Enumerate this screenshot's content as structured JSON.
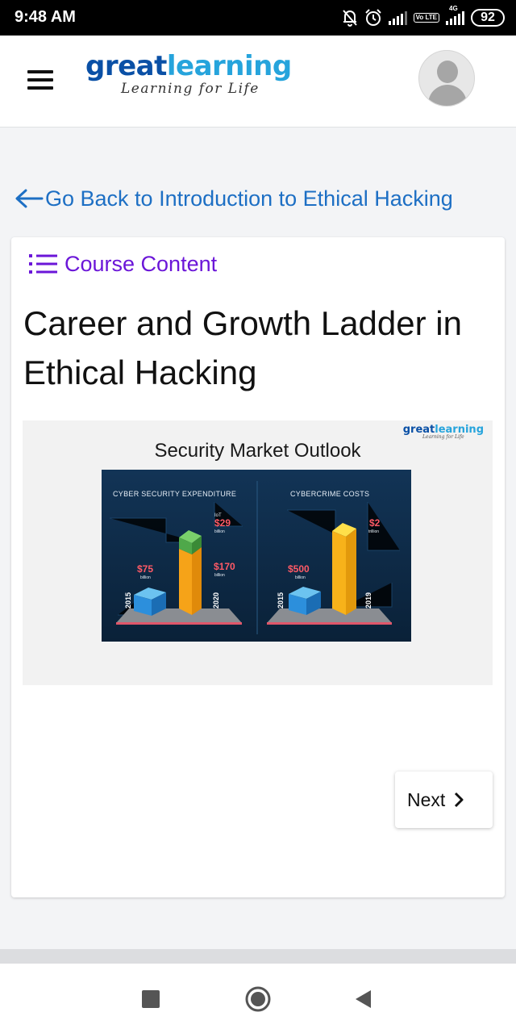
{
  "status_bar": {
    "time": "9:48 AM",
    "network_label": "4G",
    "volte_label": "Vo LTE",
    "battery": "92",
    "icons": [
      "mute-icon",
      "alarm-icon",
      "signal-icon",
      "volte-icon",
      "signal-4g-icon",
      "battery-icon"
    ]
  },
  "header": {
    "menu_icon": "hamburger-icon",
    "logo_part1": "great",
    "logo_part2": "learning",
    "logo_tagline": "Learning for Life",
    "avatar_icon": "user-avatar-icon",
    "colors": {
      "logo_dark": "#0a50a6",
      "logo_light": "#26a4dc"
    }
  },
  "back_link": {
    "label": "Go Back to Introduction to Ethical Hacking",
    "icon": "arrow-left-icon",
    "color": "#1d6fc4"
  },
  "lesson": {
    "course_content_label": "Course Content",
    "course_content_icon": "list-icon",
    "course_content_color": "#6b16d8",
    "title": "Career and Growth Ladder in Ethical Hacking"
  },
  "slide": {
    "logo_part1": "great",
    "logo_part2": "learning",
    "logo_tagline": "Learning for Life",
    "title": "Security Market Outlook",
    "panels": [
      {
        "heading": "CYBER SECURITY EXPENDITURE",
        "bars": [
          {
            "year": "2015",
            "value": "$75",
            "unit": "billion"
          },
          {
            "year": "2020",
            "value": "$170",
            "unit": "billion"
          }
        ],
        "top_block": {
          "label": "IoT",
          "value": "$29",
          "unit": "billion"
        }
      },
      {
        "heading": "CYBERCRIME COSTS",
        "bars": [
          {
            "year": "2015",
            "value": "$500",
            "unit": "billion"
          },
          {
            "year": "2019",
            "value": "$2",
            "unit": "trillion"
          }
        ]
      }
    ]
  },
  "navigation": {
    "next_label": "Next",
    "next_icon": "chevron-right-icon"
  },
  "system_nav": {
    "recents_icon": "recents-square-icon",
    "home_icon": "home-circle-icon",
    "back_icon": "back-triangle-icon"
  }
}
